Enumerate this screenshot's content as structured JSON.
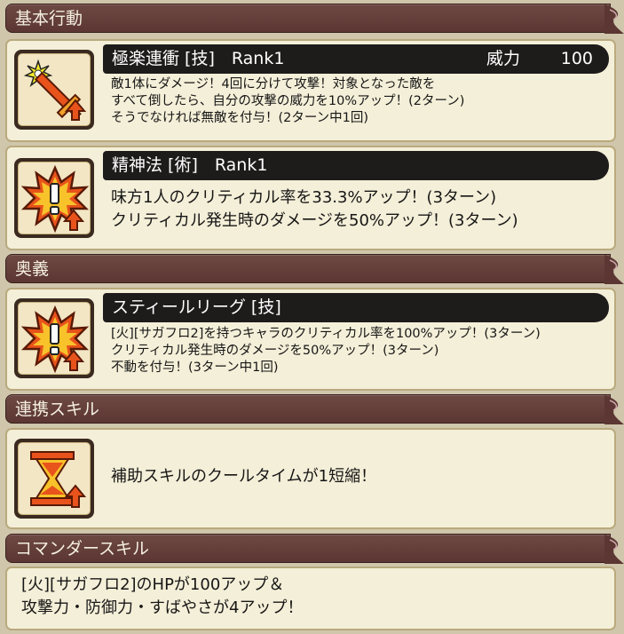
{
  "sections": {
    "basic": "基本行動",
    "ougi": "奥義",
    "renkei": "連携スキル",
    "commander": "コマンダースキル"
  },
  "skills": [
    {
      "icon": "sword-attack-icon",
      "title": "極楽連衝 [技]　Rank1",
      "power_label": "威力",
      "power_value": "100",
      "lines": [
        "敵1体にダメージ！4回に分けて攻撃！対象となった敵を",
        "すべて倒したら、自分の攻撃の威力を10%アップ！(2ターン)",
        "そうでなければ無敵を付与！(2ターン中1回)"
      ]
    },
    {
      "icon": "buff-burst-icon",
      "title": "精神法 [術]　Rank1",
      "lines": [
        "味方1人のクリティカル率を33.3%アップ！(3ターン)",
        "クリティカル発生時のダメージを50%アップ！(3ターン)"
      ]
    },
    {
      "icon": "buff-burst-icon",
      "title": "スティールリーグ [技]",
      "lines": [
        "[火][サガフロ2]を持つキャラのクリティカル率を100%アップ！(3ターン)",
        "クリティカル発生時のダメージを50%アップ！(3ターン)",
        "不動を付与！(3ターン中1回)"
      ]
    }
  ],
  "renkei": {
    "icon": "hourglass-up-icon",
    "text": "補助スキルのクールタイムが1短縮！"
  },
  "commander": {
    "lines": [
      "[火][サガフロ2]のHPが100アップ＆",
      "攻撃力・防御力・すばやさが4アップ！"
    ]
  },
  "colors": {
    "header_bg": "#5b3632",
    "card_bg": "#f4efd8",
    "title_bar": "#1e1b1b",
    "icon_orange": "#e8531b"
  }
}
